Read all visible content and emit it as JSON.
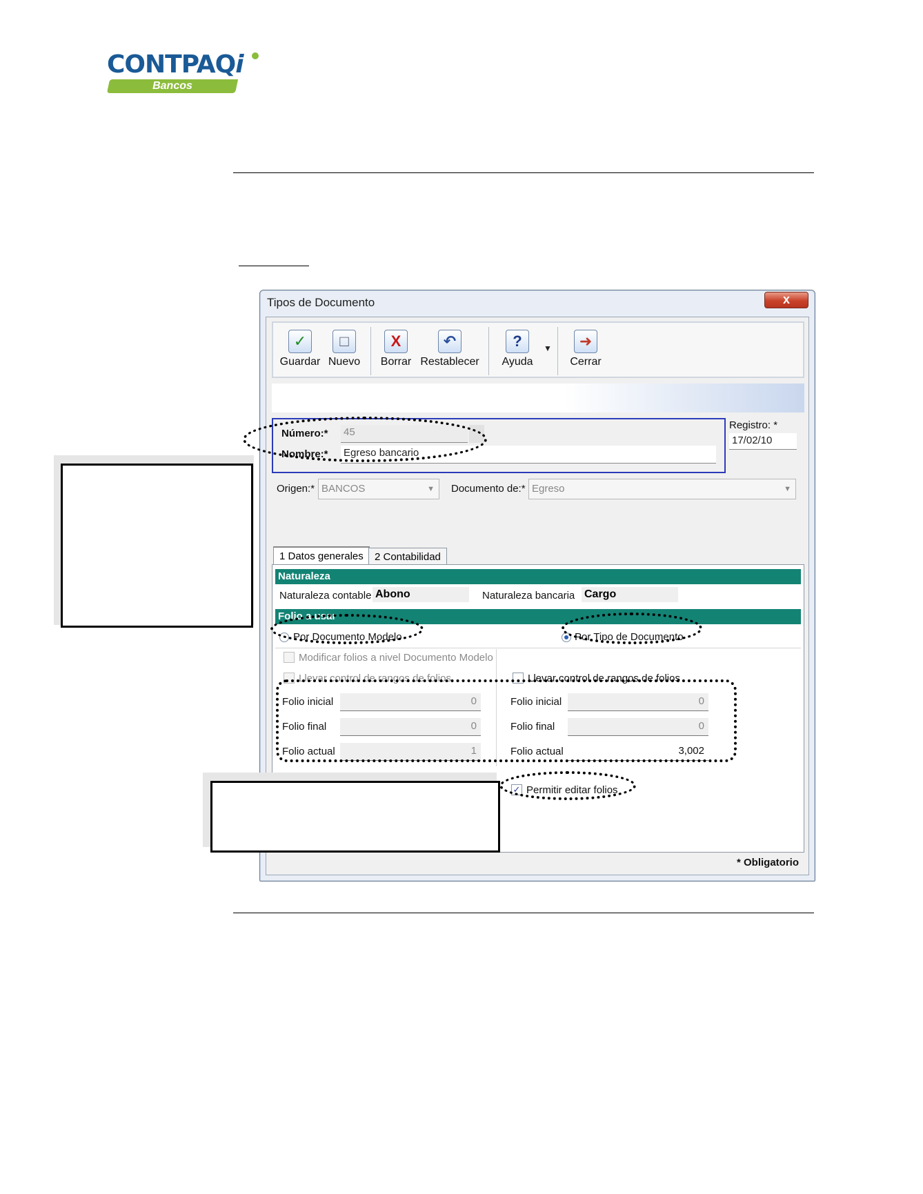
{
  "logo": {
    "brand": "CONTPAQ",
    "brand_i": "i",
    "product": "Bancos"
  },
  "window": {
    "title": "Tipos de Documento",
    "close": "x"
  },
  "toolbar": {
    "guardar": "Guardar",
    "nuevo": "Nuevo",
    "borrar": "Borrar",
    "restablecer": "Restablecer",
    "ayuda": "Ayuda",
    "cerrar": "Cerrar"
  },
  "form": {
    "numero_label": "Número:*",
    "numero_value": "45",
    "nombre_label": "Nombre:*",
    "nombre_value": "Egreso bancario",
    "registro_label": "Registro: *",
    "registro_value": "17/02/10",
    "origen_label": "Origen:*",
    "origen_value": "BANCOS",
    "documento_label": "Documento de:*",
    "documento_value": "Egreso"
  },
  "tabs": {
    "tab1": "1 Datos generales",
    "tab2": "2 Contabilidad"
  },
  "naturaleza": {
    "header": "Naturaleza",
    "contable_label": "Naturaleza contable",
    "contable_value": "Abono",
    "bancaria_label": "Naturaleza bancaria",
    "bancaria_value": "Cargo"
  },
  "folio": {
    "header": "Folio a usar",
    "por_modelo": "Por Documento Modelo",
    "por_tipo": "Por Tipo de Documento",
    "modificar": "Modificar folios a nivel Documento Modelo",
    "llevar_left": "Llevar control de rangos de folios",
    "llevar_right": "Llevar control de rangos de folios",
    "inicial_label": "Folio inicial",
    "final_label": "Folio final",
    "actual_label": "Folio actual",
    "left_inicial": "0",
    "left_final": "0",
    "left_actual": "1",
    "right_inicial": "0",
    "right_final": "0",
    "right_actual": "3,002",
    "permitir": "Permitir editar folios",
    "por_tipo_selected": true,
    "permitir_checked": true
  },
  "footer": {
    "obligatorio": "* Obligatorio"
  },
  "colors": {
    "section": "#138374",
    "brand": "#1a5a96",
    "brand_green": "#8cbc3c"
  }
}
